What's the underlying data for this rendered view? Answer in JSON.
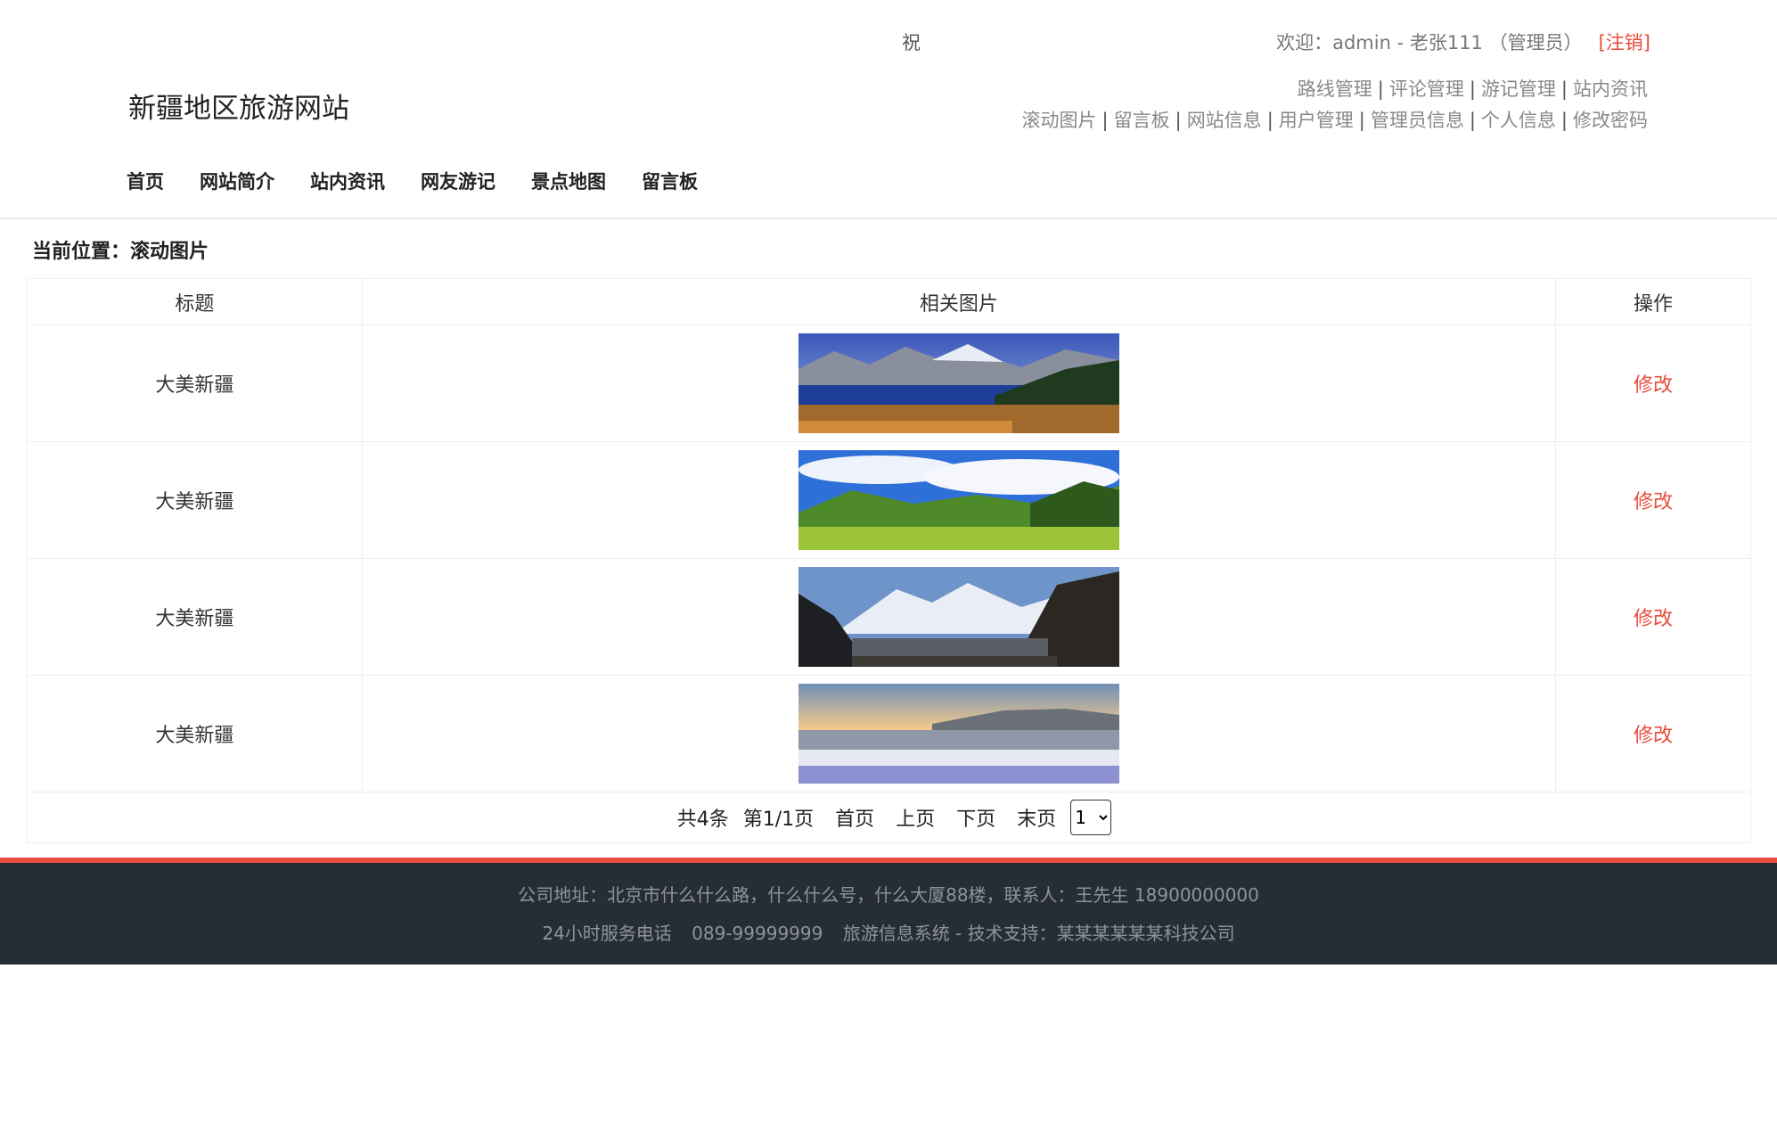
{
  "header": {
    "marquee": "祝 ",
    "welcome_prefix": "欢迎：admin - 老张111 （管理员）",
    "logout": "[注销]",
    "site_title": "新疆地区旅游网站",
    "admin_row1": [
      "路线管理",
      "评论管理",
      "游记管理",
      "站内资讯"
    ],
    "admin_row2": [
      "滚动图片",
      "留言板",
      "网站信息",
      "用户管理",
      "管理员信息",
      "个人信息",
      "修改密码"
    ],
    "separator": "|"
  },
  "nav": [
    "首页",
    "网站简介",
    "站内资讯",
    "网友游记",
    "景点地图",
    "留言板"
  ],
  "breadcrumb": "当前位置：滚动图片",
  "table": {
    "headers": [
      "标题",
      "相关图片",
      "操作"
    ],
    "rows": [
      {
        "title": "大美新疆",
        "action": "修改",
        "image": "mountain-lake-scene"
      },
      {
        "title": "大美新疆",
        "action": "修改",
        "image": "green-grassland-scene"
      },
      {
        "title": "大美新疆",
        "action": "修改",
        "image": "snow-mountain-scene"
      },
      {
        "title": "大美新疆",
        "action": "修改",
        "image": "sunset-lake-scene"
      }
    ]
  },
  "pager": {
    "total": "共4条",
    "page_info": "第1/1页",
    "first": "首页",
    "prev": "上页",
    "next": "下页",
    "last": "末页",
    "selected": "1"
  },
  "footer": {
    "address": "公司地址：北京市什么什么路，什么什么号，什么大厦88楼，联系人：王先生 18900000000",
    "hotline_label": "24小时服务电话",
    "hotline": "089-99999999",
    "support": "旅游信息系统 - 技术支持：某某某某某某科技公司"
  },
  "colors": {
    "accent": "#e74c3c",
    "footer_bg": "#272d36"
  }
}
